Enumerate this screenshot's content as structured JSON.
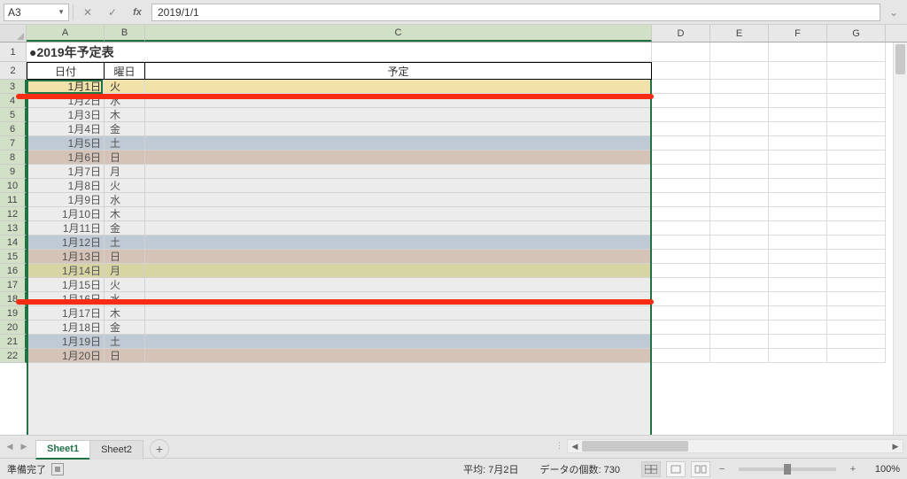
{
  "nameBox": "A3",
  "formula": "2019/1/1",
  "columns": [
    "A",
    "B",
    "C",
    "D",
    "E",
    "F",
    "G"
  ],
  "title": "●2019年予定表",
  "headerRow": {
    "date": "日付",
    "day": "曜日",
    "plan": "予定"
  },
  "rows": [
    {
      "n": 3,
      "date": "1月1日",
      "day": "火",
      "cls": "bg-hol"
    },
    {
      "n": 4,
      "date": "1月2日",
      "day": "水",
      "cls": ""
    },
    {
      "n": 5,
      "date": "1月3日",
      "day": "木",
      "cls": ""
    },
    {
      "n": 6,
      "date": "1月4日",
      "day": "金",
      "cls": ""
    },
    {
      "n": 7,
      "date": "1月5日",
      "day": "土",
      "cls": "bg-sat"
    },
    {
      "n": 8,
      "date": "1月6日",
      "day": "日",
      "cls": "bg-sun"
    },
    {
      "n": 9,
      "date": "1月7日",
      "day": "月",
      "cls": ""
    },
    {
      "n": 10,
      "date": "1月8日",
      "day": "火",
      "cls": ""
    },
    {
      "n": 11,
      "date": "1月9日",
      "day": "水",
      "cls": ""
    },
    {
      "n": 12,
      "date": "1月10日",
      "day": "木",
      "cls": ""
    },
    {
      "n": 13,
      "date": "1月11日",
      "day": "金",
      "cls": ""
    },
    {
      "n": 14,
      "date": "1月12日",
      "day": "土",
      "cls": "bg-sat"
    },
    {
      "n": 15,
      "date": "1月13日",
      "day": "日",
      "cls": "bg-sun"
    },
    {
      "n": 16,
      "date": "1月14日",
      "day": "月",
      "cls": "bg-seijin"
    },
    {
      "n": 17,
      "date": "1月15日",
      "day": "火",
      "cls": ""
    },
    {
      "n": 18,
      "date": "1月16日",
      "day": "水",
      "cls": ""
    },
    {
      "n": 19,
      "date": "1月17日",
      "day": "木",
      "cls": ""
    },
    {
      "n": 20,
      "date": "1月18日",
      "day": "金",
      "cls": ""
    },
    {
      "n": 21,
      "date": "1月19日",
      "day": "土",
      "cls": "bg-sat"
    },
    {
      "n": 22,
      "date": "1月20日",
      "day": "日",
      "cls": "bg-sun"
    }
  ],
  "tabs": [
    {
      "label": "Sheet1",
      "active": true
    },
    {
      "label": "Sheet2",
      "active": false
    }
  ],
  "status": {
    "ready": "準備完了",
    "avg": "平均: 7月2日",
    "count": "データの個数: 730",
    "zoom": "100%"
  }
}
